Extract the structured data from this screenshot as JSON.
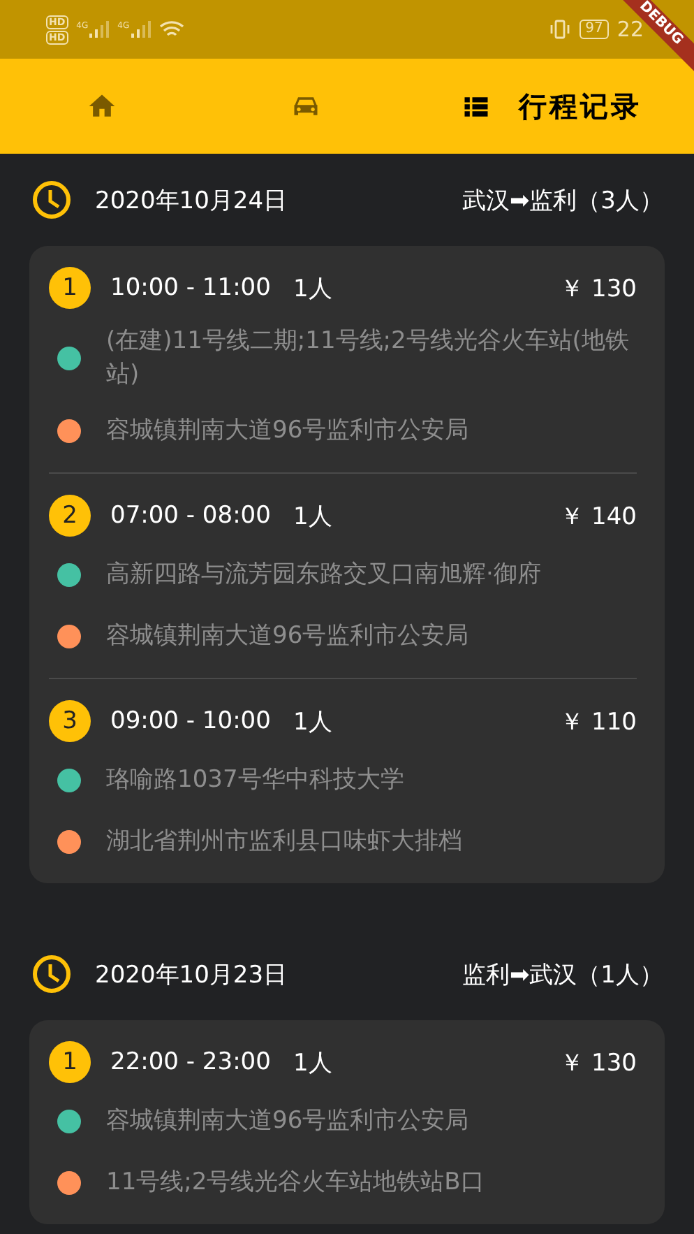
{
  "status_bar": {
    "sim_labels": [
      "HD",
      "HD"
    ],
    "network_labels": [
      "4G",
      "4G"
    ],
    "battery": "97",
    "time": "22"
  },
  "debug_banner": "DEBUG",
  "tabs": [
    {
      "kind": "home",
      "selected": false
    },
    {
      "kind": "car",
      "selected": false
    },
    {
      "kind": "list",
      "label": "行程记录",
      "selected": true
    }
  ],
  "days": [
    {
      "date": "2020年10月24日",
      "route": "武汉➡监利（3人）",
      "trips": [
        {
          "index": "1",
          "time": "10:00 - 11:00",
          "people": "1人",
          "price": "￥ 130",
          "stops": [
            {
              "text": "(在建)11号线二期;11号线;2号线光谷火车站(地铁站)",
              "color": "#45c1a3"
            },
            {
              "text": "容城镇荆南大道96号监利市公安局",
              "color": "#ff9159"
            }
          ]
        },
        {
          "index": "2",
          "time": "07:00 - 08:00",
          "people": "1人",
          "price": "￥ 140",
          "stops": [
            {
              "text": "高新四路与流芳园东路交叉口南旭辉·御府",
              "color": "#45c1a3"
            },
            {
              "text": "容城镇荆南大道96号监利市公安局",
              "color": "#ff9159"
            }
          ]
        },
        {
          "index": "3",
          "time": "09:00 - 10:00",
          "people": "1人",
          "price": "￥ 110",
          "stops": [
            {
              "text": "珞喻路1037号华中科技大学",
              "color": "#45c1a3"
            },
            {
              "text": "湖北省荆州市监利县口味虾大排档",
              "color": "#ff9159"
            }
          ]
        }
      ]
    },
    {
      "date": "2020年10月23日",
      "route": "监利➡武汉（1人）",
      "trips": [
        {
          "index": "1",
          "time": "22:00 - 23:00",
          "people": "1人",
          "price": "￥ 130",
          "stops": [
            {
              "text": "容城镇荆南大道96号监利市公安局",
              "color": "#45c1a3"
            },
            {
              "text": "11号线;2号线光谷火车站地铁站B口",
              "color": "#ff9159"
            }
          ]
        }
      ]
    }
  ]
}
